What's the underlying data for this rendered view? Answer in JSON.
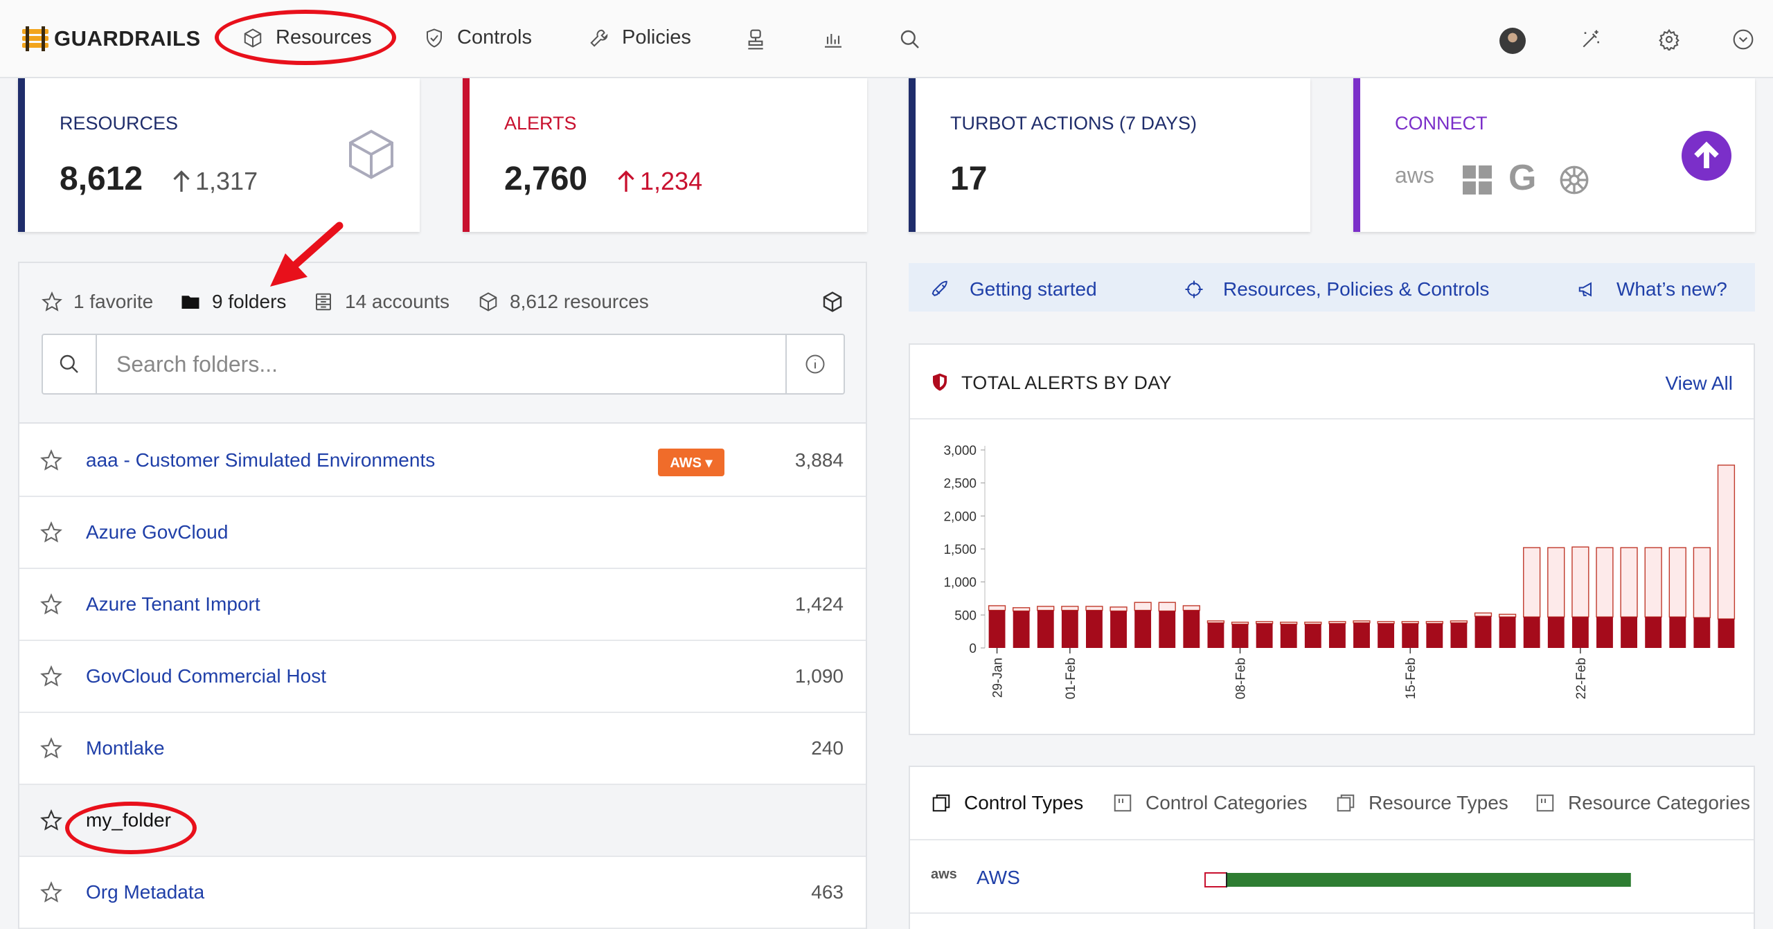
{
  "app": {
    "name": "GUARDRAILS"
  },
  "nav": {
    "items": [
      {
        "label": "Resources",
        "icon": "cube-icon"
      },
      {
        "label": "Controls",
        "icon": "shield-check-icon"
      },
      {
        "label": "Policies",
        "icon": "wrench-icon"
      }
    ],
    "icons": [
      "reports-icon",
      "bar-chart-icon",
      "search-icon",
      "avatar",
      "magic-wand-icon",
      "gear-icon",
      "chevron-circle-down-icon"
    ]
  },
  "cards": {
    "resources": {
      "title": "RESOURCES",
      "value": "8,612",
      "delta": "1,317",
      "color": "#1f2d6b"
    },
    "alerts": {
      "title": "ALERTS",
      "value": "2,760",
      "delta": "1,234",
      "color": "#c8102e"
    },
    "actions": {
      "title": "TURBOT ACTIONS (7 DAYS)",
      "value": "17",
      "color": "#1f2d6b"
    },
    "connect": {
      "title": "CONNECT",
      "providers": [
        "aws",
        "azure",
        "google",
        "kubernetes"
      ],
      "color": "#7b2fc9"
    }
  },
  "folders_panel": {
    "stats": {
      "favorites": "1 favorite",
      "folders": "9 folders",
      "accounts": "14 accounts",
      "resources": "8,612 resources"
    },
    "search_placeholder": "Search folders...",
    "rows": [
      {
        "name": "aaa - Customer Simulated Environments",
        "badge": "AWS ▾",
        "count": "3,884"
      },
      {
        "name": "Azure GovCloud",
        "count": ""
      },
      {
        "name": "Azure Tenant Import",
        "count": "1,424"
      },
      {
        "name": "GovCloud Commercial Host",
        "count": "1,090"
      },
      {
        "name": "Montlake",
        "count": "240"
      },
      {
        "name": "my_folder",
        "count": ""
      },
      {
        "name": "Org Metadata",
        "count": "463"
      }
    ]
  },
  "quick_links": {
    "getting_started": "Getting started",
    "resources_policies": "Resources, Policies & Controls",
    "whats_new": "What’s new?"
  },
  "alerts_panel": {
    "title": "TOTAL ALERTS BY DAY",
    "view_all": "View All"
  },
  "chart_data": {
    "type": "bar",
    "title": "TOTAL ALERTS BY DAY",
    "x_tick_labels": [
      "29-Jan",
      "01-Feb",
      "08-Feb",
      "15-Feb",
      "22-Feb"
    ],
    "x_tick_indices": [
      0,
      3,
      10,
      17,
      24
    ],
    "y_ticks": [
      "0",
      "500",
      "1,000",
      "1,500",
      "2,000",
      "2,500",
      "3,000"
    ],
    "ylim": [
      0,
      3000
    ],
    "series": [
      {
        "values": [
          570,
          560,
          570,
          570,
          570,
          560,
          570,
          560,
          570,
          380,
          360,
          370,
          360,
          360,
          370,
          380,
          370,
          370,
          370,
          380,
          480,
          470,
          470,
          470,
          470,
          470,
          470,
          470,
          470,
          460,
          440
        ]
      },
      {
        "values": [
          70,
          50,
          60,
          60,
          60,
          60,
          120,
          130,
          70,
          30,
          30,
          30,
          30,
          30,
          30,
          30,
          30,
          30,
          30,
          30,
          50,
          40,
          1050,
          1050,
          1060,
          1050,
          1050,
          1050,
          1050,
          1060,
          2330
        ]
      }
    ],
    "colors": [
      "#a50b1b",
      "#fdeaea"
    ]
  },
  "types_panel": {
    "tabs": [
      "Control Types",
      "Control Categories",
      "Resource Types",
      "Resource Categories"
    ],
    "rows": [
      {
        "label": "AWS",
        "icon": "aws",
        "ok_ratio": 0.94,
        "alarm_ratio": 0.05
      }
    ]
  },
  "annotations": {
    "color": "#e8101b"
  }
}
